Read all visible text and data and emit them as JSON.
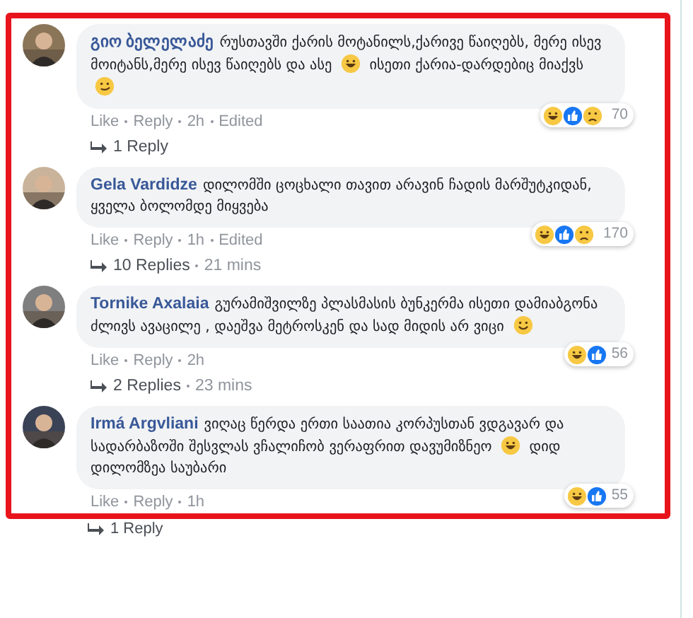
{
  "comments": [
    {
      "author": "გიო ბელელაძე",
      "parts": [
        {
          "kind": "text",
          "text": "რუსთავში ქარის მოტანილს,ქარივე წაიღებს, მერე ისევ მოიტანს,მერე ისევ წაიღებს და ასე"
        },
        {
          "kind": "laugh"
        },
        {
          "kind": "text",
          "text": "ისეთი ქარია-დარდებიც მიაქვს"
        },
        {
          "kind": "smirk"
        }
      ],
      "reactions": [
        {
          "kind": "haha"
        },
        {
          "kind": "like"
        },
        {
          "kind": "sad"
        }
      ],
      "reaction_count": "70",
      "actions": [
        "Like",
        "Reply",
        "2h",
        "Edited"
      ],
      "replies": {
        "label": "1 Reply"
      }
    },
    {
      "author": "Gela Vardidze",
      "parts": [
        {
          "kind": "text",
          "text": "დილომში ცოცხალი თავით არავინ ჩადის მარშუტკიდან, ყველა ბოლომდე მიყვება"
        }
      ],
      "reactions": [
        {
          "kind": "haha"
        },
        {
          "kind": "like"
        },
        {
          "kind": "sad"
        }
      ],
      "reaction_count": "170",
      "actions": [
        "Like",
        "Reply",
        "1h",
        "Edited"
      ],
      "replies": {
        "label": "10 Replies",
        "time": "21 mins"
      }
    },
    {
      "author": "Tornike Axalaia",
      "parts": [
        {
          "kind": "text",
          "text": "გურამიშვილზე პლასმასის ბუნკერმა ისეთი დამიაბგონა ძლივს ავაცილე , დაეშვა მეტროსკენ და სად მიდის არ ვიცი"
        },
        {
          "kind": "smile"
        }
      ],
      "reactions": [
        {
          "kind": "haha"
        },
        {
          "kind": "like"
        }
      ],
      "reaction_count": "56",
      "actions": [
        "Like",
        "Reply",
        "2h"
      ],
      "replies": {
        "label": "2 Replies",
        "time": "23 mins"
      }
    },
    {
      "author": "Irmá Argvliani",
      "parts": [
        {
          "kind": "text",
          "text": "ვიღაც წერდა ერთი საათია კორპუსთან ვდგავარ და სადარბაზოში შესვლას ვჩალიჩობ ვერაფრით დავუმიზნეო"
        },
        {
          "kind": "laugh"
        },
        {
          "kind": "text",
          "text": "დიდ დილომზეა საუბარი"
        }
      ],
      "reactions": [
        {
          "kind": "haha"
        },
        {
          "kind": "like"
        }
      ],
      "reaction_count": "55",
      "actions": [
        "Like",
        "Reply",
        "1h"
      ]
    }
  ],
  "next_replies": {
    "label": "1 Reply"
  }
}
